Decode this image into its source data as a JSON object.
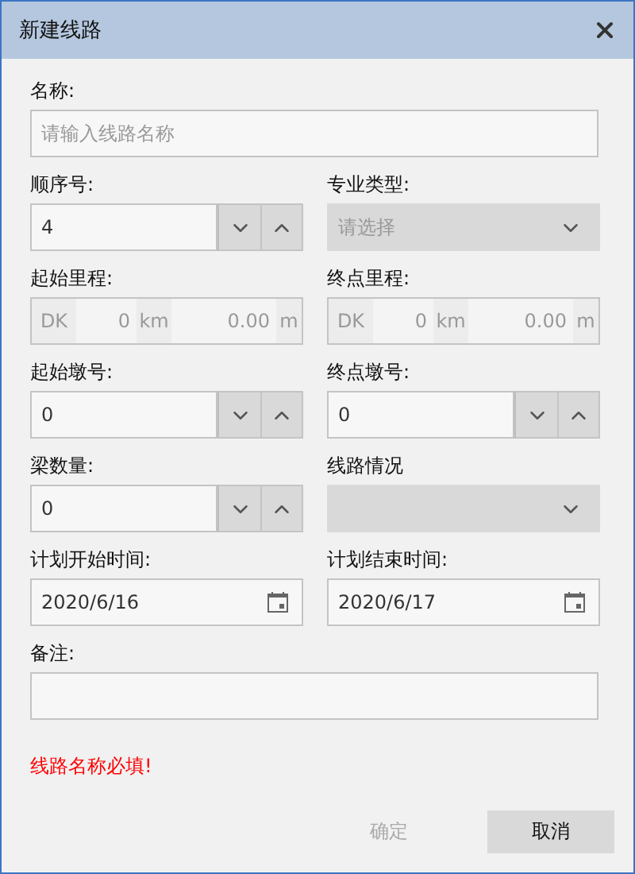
{
  "window": {
    "title": "新建线路"
  },
  "rows": [
    [
      {
        "kind": "text",
        "label": "名称:",
        "placeholder": "请输入线路名称"
      }
    ],
    [
      {
        "kind": "spinner",
        "label": "顺序号:",
        "value": "4"
      },
      {
        "kind": "select",
        "label": "专业类型:",
        "placeholder": "请选择"
      }
    ],
    [
      {
        "kind": "mileage",
        "label": "起始里程:",
        "prefix": "DK",
        "km": "0",
        "km_unit": "km",
        "m": "0.00",
        "m_unit": "m",
        "disabled": true
      },
      {
        "kind": "mileage",
        "label": "终点里程:",
        "prefix": "DK",
        "km": "0",
        "km_unit": "km",
        "m": "0.00",
        "m_unit": "m",
        "disabled": true
      }
    ],
    [
      {
        "kind": "spinner",
        "label": "起始墩号:",
        "value": "0"
      },
      {
        "kind": "spinner",
        "label": "终点墩号:",
        "value": "0"
      }
    ],
    [
      {
        "kind": "spinner",
        "label": "梁数量:",
        "value": "0"
      },
      {
        "kind": "select",
        "label": "线路情况"
      }
    ],
    [
      {
        "kind": "date",
        "label": "计划开始时间:",
        "value": "2020/6/16"
      },
      {
        "kind": "date",
        "label": "计划结束时间:",
        "value": "2020/6/17"
      }
    ],
    [
      {
        "kind": "text",
        "label": "备注:"
      }
    ]
  ],
  "error": "线路名称必填!",
  "buttons": [
    {
      "label": "确定",
      "disabled": true
    },
    {
      "label": "取消",
      "disabled": false
    }
  ]
}
